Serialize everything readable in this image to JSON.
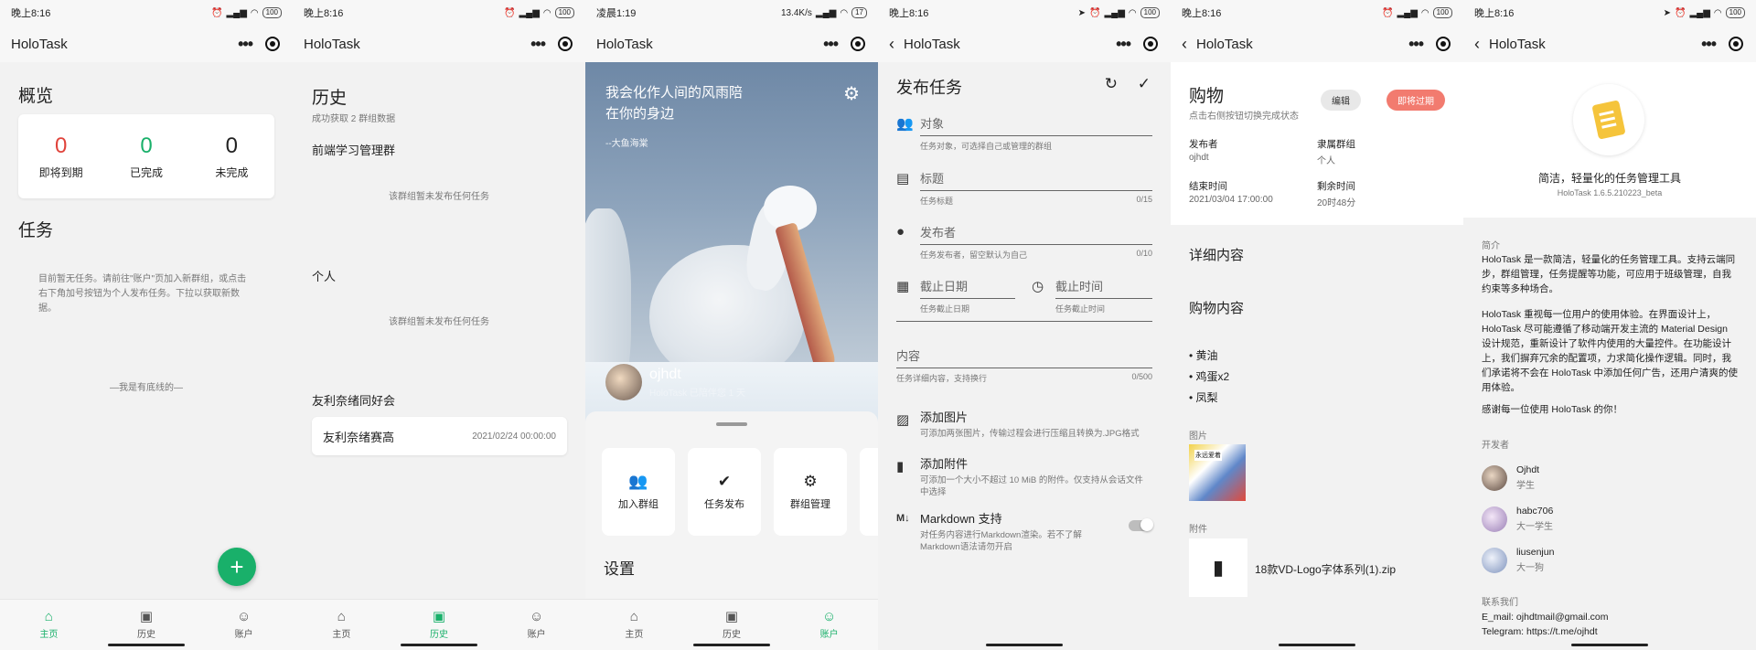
{
  "screens": [
    {
      "status": {
        "time": "晚上8:16",
        "battery": "100"
      },
      "app_title": "HoloTask",
      "overview_title": "概览",
      "stats": [
        {
          "value": "0",
          "label": "即将到期",
          "color": "#e0433b"
        },
        {
          "value": "0",
          "label": "已完成",
          "color": "#19b06a"
        },
        {
          "value": "0",
          "label": "未完成",
          "color": "#222222"
        }
      ],
      "tasks_title": "任务",
      "empty_text": "目前暂无任务。请前往\"账户\"页加入新群组，或点击右下角加号按钮为个人发布任务。下拉以获取新数据。",
      "bottom_line": "—我是有底线的—",
      "fab": "+"
    },
    {
      "status": {
        "time": "晚上8:16",
        "battery": "100"
      },
      "app_title": "HoloTask",
      "history_title": "历史",
      "history_sub": "成功获取 2 群组数据",
      "groups": [
        {
          "name": "前端学习管理群",
          "empty": "该群组暂未发布任何任务"
        },
        {
          "name": "个人",
          "empty": "该群组暂未发布任何任务"
        },
        {
          "name": "友利奈绪同好会",
          "task": {
            "title": "友利奈绪赛高",
            "time": "2021/02/24 00:00:00"
          }
        }
      ]
    },
    {
      "status": {
        "time": "凌晨1:19",
        "speed": "13.4K/s",
        "battery": "17"
      },
      "app_title": "HoloTask",
      "quote_line1": "我会化作人间的风雨陪",
      "quote_line2": "在你的身边",
      "quote_author": "--大鱼海棠",
      "username": "ojhdt",
      "user_sub": "HoloTask 已陪伴您 1 天",
      "shortcuts": [
        {
          "icon": "join-group-icon",
          "label": "加入群组"
        },
        {
          "icon": "task-publish-icon",
          "label": "任务发布"
        },
        {
          "icon": "group-manage-icon",
          "label": "群组管理"
        }
      ],
      "settings_title": "设置"
    },
    {
      "status": {
        "time": "晚上8:16",
        "battery": "100"
      },
      "nav_title": "HoloTask",
      "page_title": "发布任务",
      "fields": {
        "target": {
          "label": "对象",
          "help": "任务对象，可选择自己或管理的群组",
          "count": ""
        },
        "title": {
          "label": "标题",
          "help": "任务标题",
          "count": "0/15"
        },
        "publisher": {
          "label": "发布者",
          "help": "任务发布者，留空默认为自己",
          "count": "0/10"
        },
        "date": {
          "label": "截止日期",
          "help": "任务截止日期"
        },
        "time": {
          "label": "截止时间",
          "help": "任务截止时间"
        },
        "content": {
          "label": "内容",
          "help": "任务详细内容，支持换行",
          "count": "0/500"
        }
      },
      "options": [
        {
          "title": "添加图片",
          "desc": "可添加两张图片，传输过程会进行压缩且转换为.JPG格式"
        },
        {
          "title": "添加附件",
          "desc": "可添加一个大小不超过 10 MiB 的附件。仅支持从会话文件中选择"
        },
        {
          "title": "Markdown 支持",
          "desc": "对任务内容进行Markdown渲染。若不了解Markdown语法请勿开启",
          "toggle": false
        }
      ]
    },
    {
      "status": {
        "time": "晚上8:16",
        "battery": "100"
      },
      "nav_title": "HoloTask",
      "task_title": "购物",
      "task_hint": "点击右侧按钮切换完成状态",
      "edit_label": "编辑",
      "status_label": "即将过期",
      "meta": {
        "publisher_k": "发布者",
        "publisher_v": "ojhdt",
        "group_k": "隶属群组",
        "group_v": "个人",
        "end_k": "结束时间",
        "end_v": "2021/03/04 17:00:00",
        "remain_k": "剩余时间",
        "remain_v": "20时48分"
      },
      "detail_title": "详细内容",
      "content_title": "购物内容",
      "items": [
        "• 黄油",
        "• 鸡蛋x2",
        "• 凤梨"
      ],
      "images_label": "图片",
      "image_caption": "永远爱着",
      "attach_label": "附件",
      "attach_name": "18款VD-Logo字体系列(1).zip"
    },
    {
      "status": {
        "time": "晚上8:16",
        "battery": "100"
      },
      "nav_title": "HoloTask",
      "tagline": "简洁，轻量化的任务管理工具",
      "version": "HoloTask 1.6.5.210223_beta",
      "intro_label": "简介",
      "intro_p1": "HoloTask 是一款简洁，轻量化的任务管理工具。支持云端同步，群组管理，任务提醒等功能，可应用于班级管理，自我约束等多种场合。",
      "intro_p2": "HoloTask 重视每一位用户的使用体验。在界面设计上，HoloTask 尽可能遵循了移动端开发主流的 Material Design 设计规范，重新设计了软件内使用的大量控件。在功能设计上，我们摒弃冗余的配置项，力求简化操作逻辑。同时，我们承诺将不会在 HoloTask 中添加任何广告，还用户清爽的使用体验。",
      "intro_p3": "感谢每一位使用 HoloTask 的你！",
      "dev_label": "开发者",
      "devs": [
        {
          "name": "Ojhdt",
          "role": "学生"
        },
        {
          "name": "habc706",
          "role": "大一学生"
        },
        {
          "name": "liusenjun",
          "role": "大一狗"
        }
      ],
      "contact_label": "联系我们",
      "email": "E_mail: ojhdtmail@gmail.com",
      "telegram": "Telegram: https://t.me/ojhdt"
    }
  ],
  "nav": {
    "home": "主页",
    "history": "历史",
    "account": "账户"
  },
  "colors": {
    "accent": "#19b06a",
    "danger": "#e0433b"
  }
}
